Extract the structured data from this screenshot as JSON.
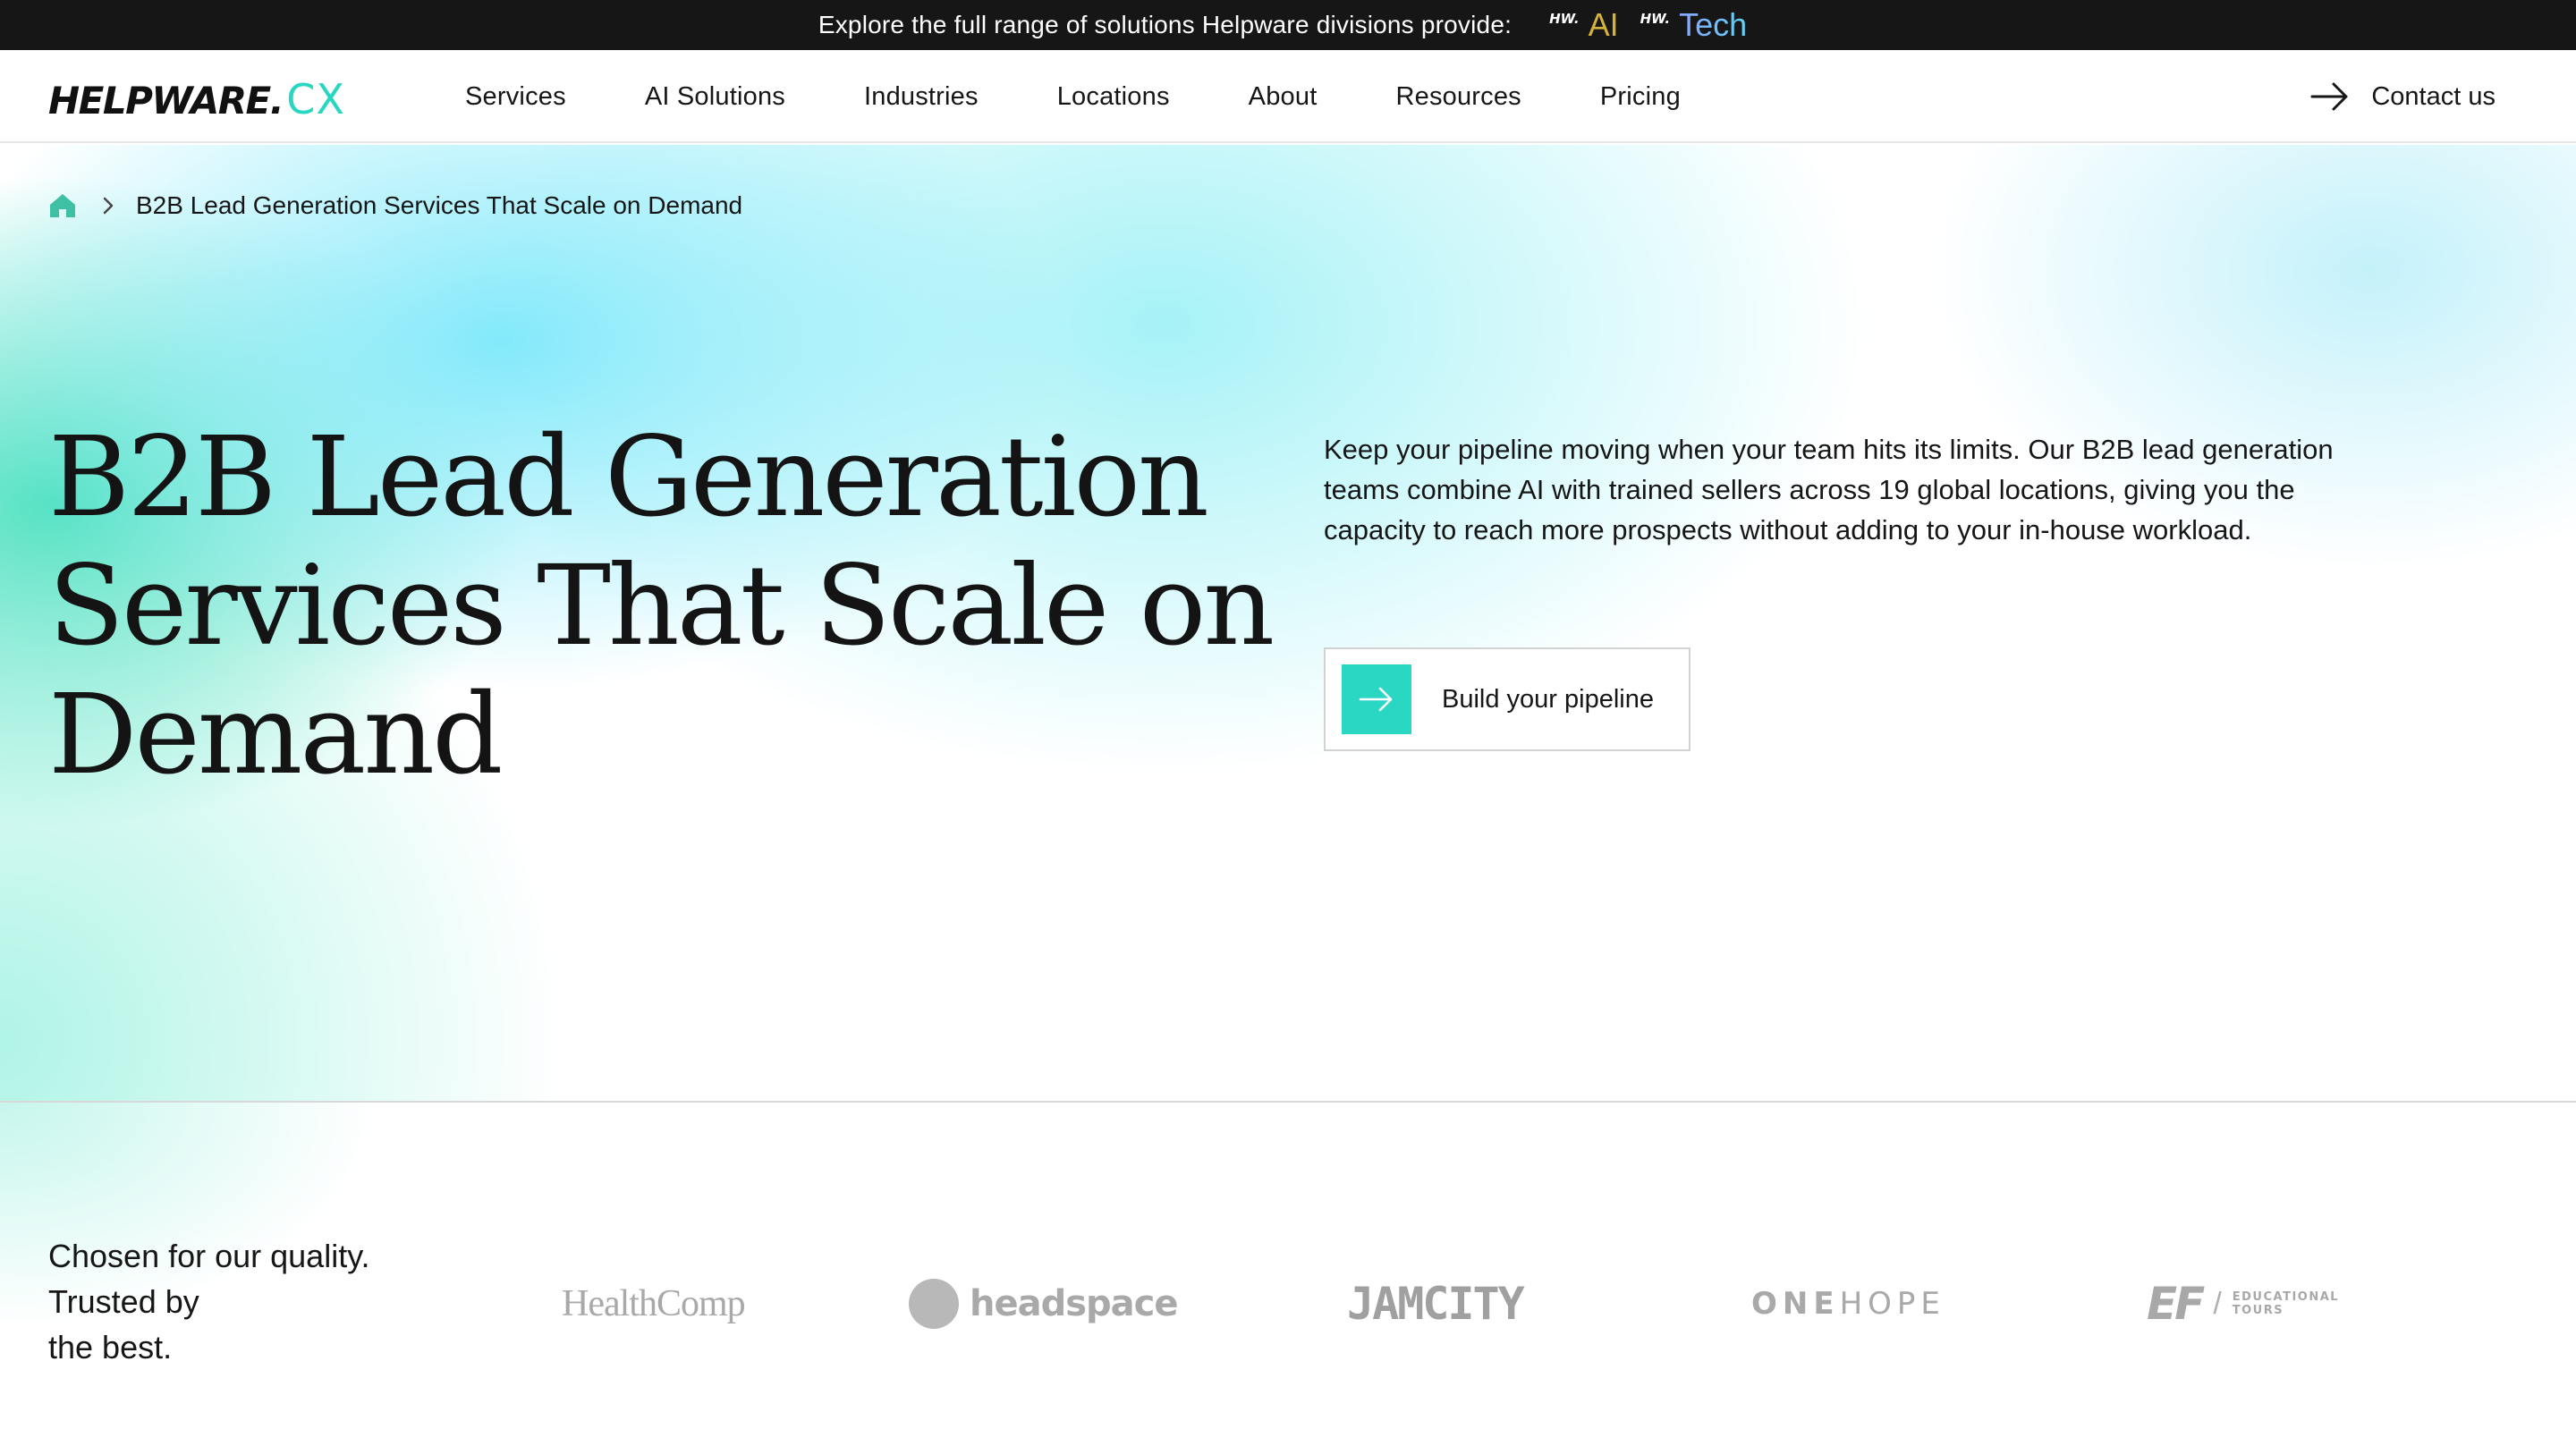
{
  "topbar": {
    "text": "Explore the full range of solutions Helpware divisions provide:",
    "divisions": [
      {
        "mark": "HW.",
        "name": "AI",
        "color": "#d4b23c"
      },
      {
        "mark": "HW.",
        "name": "Tech",
        "color": "#8aa3ff"
      }
    ]
  },
  "header": {
    "logo": {
      "main": "HELPWARE.",
      "suffix": "CX",
      "suffix_color": "#28d7c1"
    },
    "nav": [
      "Services",
      "AI Solutions",
      "Industries",
      "Locations",
      "About",
      "Resources",
      "Pricing"
    ],
    "contact": {
      "label": "Contact us",
      "icon": "arrow-right-icon"
    }
  },
  "breadcrumb": {
    "home_icon": "home-icon",
    "current": "B2B Lead Generation Services That Scale on Demand"
  },
  "hero": {
    "title": "B2B Lead Generation Services That Scale on Demand",
    "description": "Keep your pipeline moving when your team hits its limits. Our B2B lead generation teams combine AI with trained sellers across 19 global locations, giving you the capacity to reach more prospects without adding to your in-house workload.",
    "cta": {
      "label": "Build your pipeline",
      "icon": "arrow-right-icon",
      "accent": "#29d7c3"
    }
  },
  "trust": {
    "heading_lines": [
      "Chosen for our quality.",
      "Trusted by",
      "the best."
    ],
    "clients": [
      {
        "name": "HealthComp",
        "display": "HealthComp"
      },
      {
        "name": "headspace",
        "display": "headspace"
      },
      {
        "name": "JAMCITY",
        "display": "JAMCITY"
      },
      {
        "name": "ONEHOPE",
        "display_a": "ONE",
        "display_b": "HOPE"
      },
      {
        "name": "EF Educational Tours",
        "mark": "EF",
        "sub": "EDUCATIONAL TOURS"
      }
    ]
  }
}
